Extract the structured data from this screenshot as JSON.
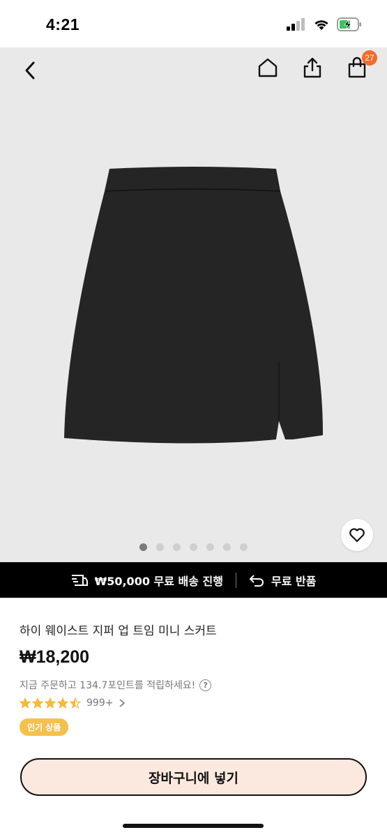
{
  "status_bar": {
    "time": "4:21"
  },
  "header": {
    "cart_count": "27"
  },
  "gallery": {
    "total_images": 7,
    "active_index": 0
  },
  "promo": {
    "free_shipping": "₩50,000 무료 배송 진행",
    "free_return": "무료 반품"
  },
  "product": {
    "title": "하이 웨이스트 지퍼 업 트임 미니 스커트",
    "price": "₩18,200",
    "points_text": "지금 주문하고 134.7포인트를 적립하세요!",
    "help_symbol": "?",
    "rating": 4.5,
    "review_count": "999+",
    "badge": "인기 상품"
  },
  "cart_button": {
    "label": "장바구니에 넣기"
  },
  "colors": {
    "accent_badge": "#f36b2b",
    "popular_badge": "#f5c14d",
    "star": "#f5b93b",
    "button_bg": "#fbe9df"
  }
}
